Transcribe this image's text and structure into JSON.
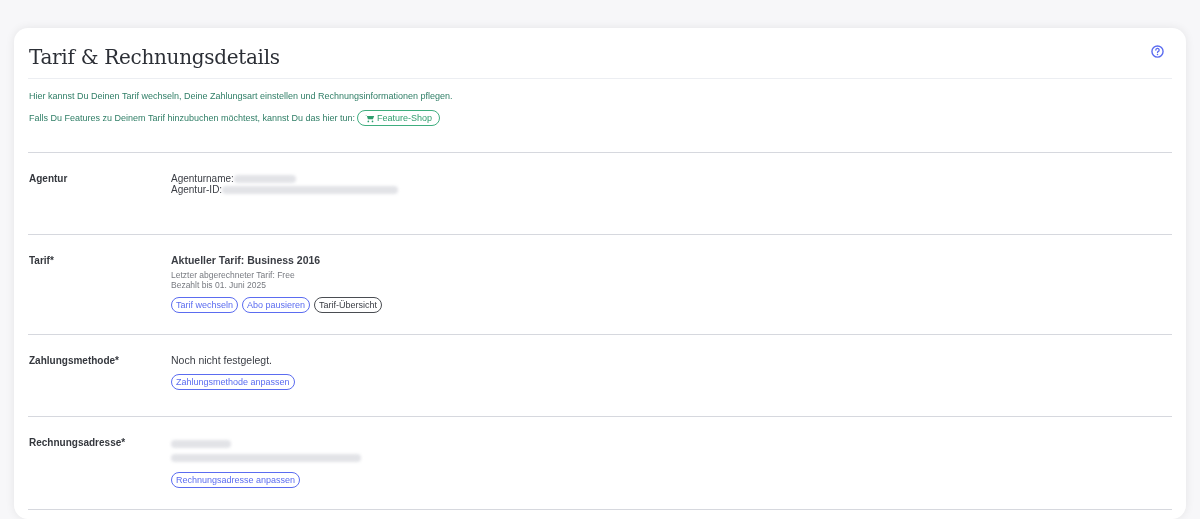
{
  "card": {
    "title": "Tarif & Rechnungsdetails",
    "intro": [
      "Hier kannst Du Deinen Tarif wechseln, Deine Zahlungsart einstellen und Rechnungsinformationen pflegen.",
      "Falls Du Features zu Deinem Tarif hinzubuchen möchtest, kannst Du das hier tun:"
    ],
    "shop_button": "Feature-Shop",
    "sections": [
      {
        "label": "Agentur",
        "lines": [
          {
            "kind": "field",
            "text": "Agenturname:",
            "redacted": true
          },
          {
            "kind": "field",
            "text": "Agentur-ID:",
            "redacted": true
          }
        ]
      },
      {
        "label": "Tarif*",
        "lines": [
          {
            "kind": "heading",
            "text": "Aktueller Tarif: Business 2016"
          },
          {
            "kind": "note",
            "text": "Letzter abgerechneter Tarif: Free"
          },
          {
            "kind": "note",
            "text": "Bezahlt bis 01. Juni 2025"
          }
        ],
        "buttons": [
          {
            "label": "Tarif wechseln",
            "kind": "primary"
          },
          {
            "label": "Abo pausieren",
            "kind": "primary"
          },
          {
            "label": "Tarif-Übersicht",
            "kind": "secondary"
          }
        ]
      },
      {
        "label": "Zahlungsmethode*",
        "lines": [
          {
            "kind": "value",
            "text": "Noch nicht festgelegt."
          }
        ],
        "buttons": [
          {
            "label": "Zahlungsmethode anpassen",
            "kind": "primary"
          }
        ]
      },
      {
        "label": "Rechnungsadresse*",
        "lines": [
          {
            "kind": "hidden"
          },
          {
            "kind": "hidden"
          }
        ],
        "buttons": [
          {
            "label": "Rechnungsadresse anpassen",
            "kind": "primary"
          }
        ]
      }
    ]
  }
}
